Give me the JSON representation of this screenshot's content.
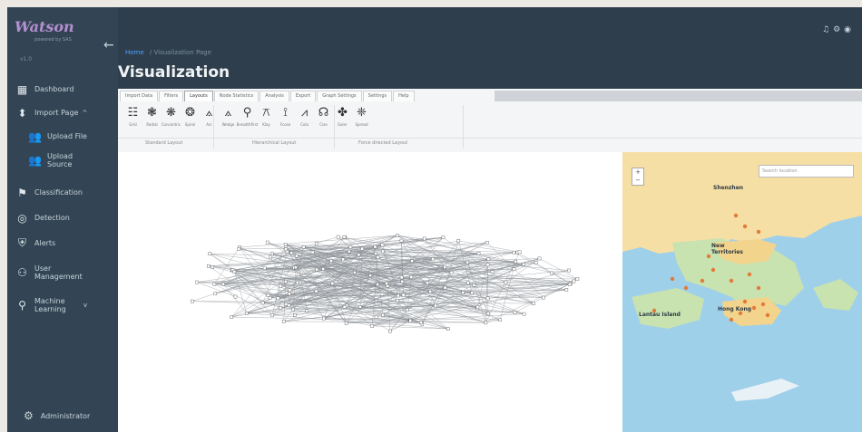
{
  "app": {
    "logo": "Watson",
    "logo_sub": "powered by SAS",
    "version": "v1.0"
  },
  "sidebar": {
    "items": [
      {
        "label": "Dashboard",
        "icon": "dashboard-icon"
      },
      {
        "label": "Import Page",
        "icon": "import-icon",
        "chevron": "^"
      },
      {
        "label": "Upload File",
        "icon": "users-icon"
      },
      {
        "label": "Upload Source",
        "icon": "users-icon"
      },
      {
        "label": "Classification",
        "icon": "tag-icon"
      },
      {
        "label": "Detection",
        "icon": "target-icon"
      },
      {
        "label": "Alerts",
        "icon": "shield-icon"
      },
      {
        "label": "User Management",
        "icon": "user-group-icon"
      },
      {
        "label": "Machine Learning",
        "icon": "location-pin-icon",
        "chevron": "v"
      }
    ],
    "footer": "Administrator"
  },
  "header": {
    "breadcrumb_home": "Home",
    "breadcrumb_current": "Visualization Page",
    "title": "Visualization",
    "icons": [
      "notification-icon",
      "settings-icon",
      "account-icon"
    ]
  },
  "ribbon": {
    "tabs": [
      "Import Data",
      "Filters",
      "Layouts",
      "Node Statistics",
      "Analysis",
      "Export",
      "Graph Settings",
      "Settings",
      "Help"
    ],
    "active_tab": "Layouts",
    "tools": [
      {
        "glyph": "☷",
        "label": "Grid"
      },
      {
        "glyph": "❃",
        "label": "Radial"
      },
      {
        "glyph": "❋",
        "label": "Concentric"
      },
      {
        "glyph": "❂",
        "label": "Spiral"
      },
      {
        "glyph": "⟑",
        "label": "Arc"
      },
      {
        "glyph": "⟑",
        "label": "Wedge"
      },
      {
        "glyph": "⚲",
        "label": "Breadthfirst"
      },
      {
        "glyph": "⚻",
        "label": "Klay"
      },
      {
        "glyph": "⟟",
        "label": "Fcose"
      },
      {
        "glyph": "⩘",
        "label": "Cola"
      },
      {
        "glyph": "☊",
        "label": "Cise"
      },
      {
        "glyph": "✤",
        "label": "Euler"
      },
      {
        "glyph": "❈",
        "label": "Spread"
      }
    ],
    "groups": [
      "Standard Layout",
      "Hierarchical Layout",
      "Force directed Layout"
    ]
  },
  "map": {
    "search_placeholder": "Search location",
    "labels": [
      "Shenzhen",
      "New Territories",
      "Lantau Island",
      "Hong Kong"
    ]
  }
}
